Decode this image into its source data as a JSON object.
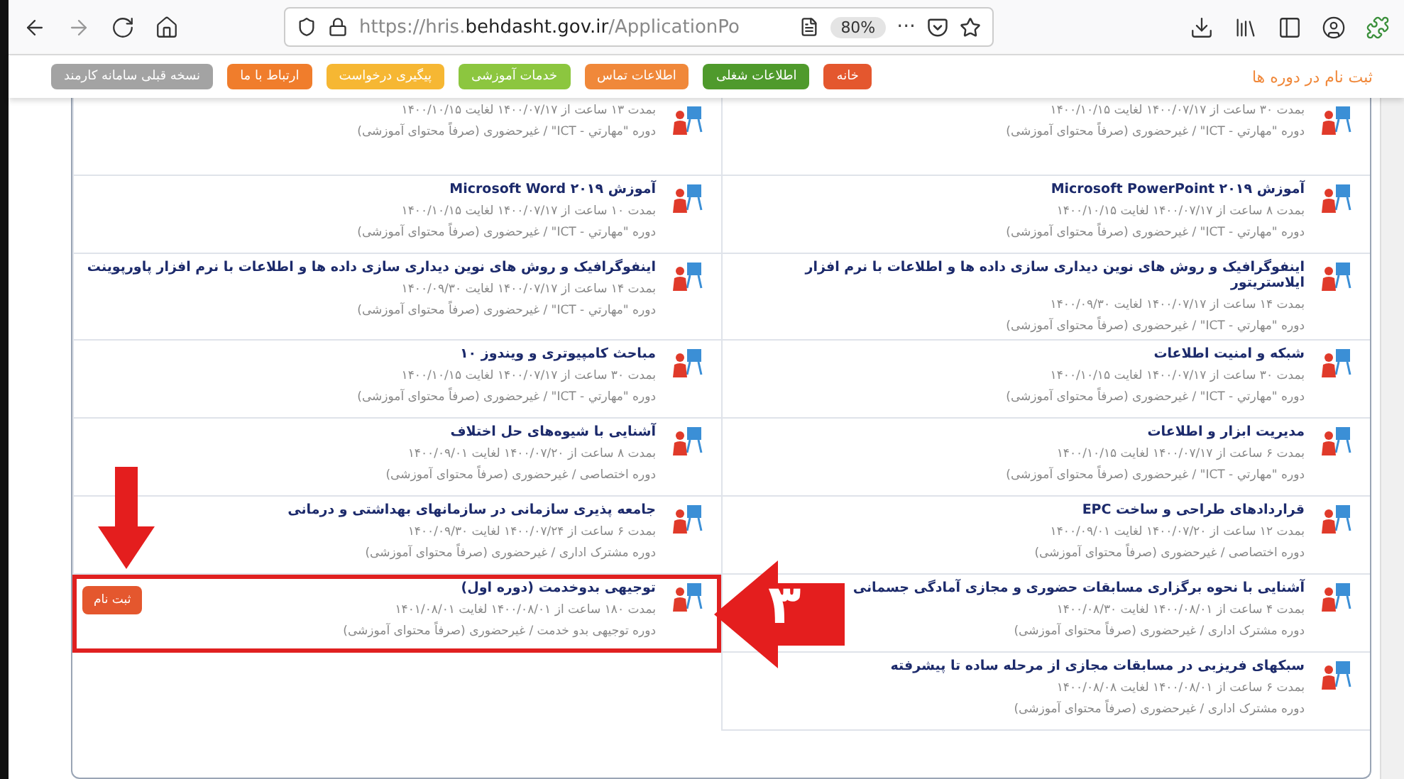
{
  "browser": {
    "url": "https://hris.**behdasht.gov.ir**/ApplicationPo",
    "zoom": "80%",
    "menu_dots": "···"
  },
  "nav": {
    "title": "ثبت نام در دوره ها",
    "buttons": [
      {
        "label": "خانه",
        "color": "#e4572e"
      },
      {
        "label": "اطلاعات شغلی",
        "color": "#4f9a2c"
      },
      {
        "label": "اطلاعات تماس",
        "color": "#f0883a"
      },
      {
        "label": "خدمات آموزشی",
        "color": "#8cc63f"
      },
      {
        "label": "پیگیری درخواست",
        "color": "#f6b733"
      },
      {
        "label": "ارتباط با ما",
        "color": "#f07d2c"
      },
      {
        "label": "نسخه قبلی سامانه کارمند",
        "color": "#a3a3a3"
      }
    ]
  },
  "courses_right": [
    {
      "duration": "بمدت ۳۰ ساعت از ۱۴۰۰/۰۷/۱۷ لغایت ۱۴۰۰/۱۰/۱۵",
      "type": "دوره \"مهارتي - ICT\" / غیرحضوری (صرفاً محتوای آموزشی)"
    },
    {
      "title": "آموزش Microsoft PowerPoint ۲۰۱۹",
      "duration": "بمدت ۸ ساعت از ۱۴۰۰/۰۷/۱۷ لغایت ۱۴۰۰/۱۰/۱۵",
      "type": "دوره \"مهارتي - ICT\" / غیرحضوری (صرفاً محتوای آموزشی)"
    },
    {
      "title": "اینفوگرافیک و روش های نوین دیداری سازی داده ها و اطلاعات با نرم افزار ایلاستریتور",
      "duration": "بمدت ۱۴ ساعت از ۱۴۰۰/۰۷/۱۷ لغایت ۱۴۰۰/۰۹/۳۰",
      "type": "دوره \"مهارتي - ICT\" / غیرحضوری (صرفاً محتوای آموزشی)"
    },
    {
      "title": "شبکه و امنیت اطلاعات",
      "duration": "بمدت ۳۰ ساعت از ۱۴۰۰/۰۷/۱۷ لغایت ۱۴۰۰/۱۰/۱۵",
      "type": "دوره \"مهارتي - ICT\" / غیرحضوری (صرفاً محتوای آموزشی)"
    },
    {
      "title": "مدیریت ابزار و اطلاعات",
      "duration": "بمدت ۶ ساعت از ۱۴۰۰/۰۷/۱۷ لغایت ۱۴۰۰/۱۰/۱۵",
      "type": "دوره \"مهارتي - ICT\" / غیرحضوری (صرفاً محتوای آموزشی)"
    },
    {
      "title": "قراردادهای طراحی و ساخت EPC",
      "duration": "بمدت ۱۲ ساعت از ۱۴۰۰/۰۷/۲۰ لغایت ۱۴۰۰/۰۹/۰۱",
      "type": "دوره اختصاصی / غیرحضوری (صرفاً محتوای آموزشی)"
    },
    {
      "title": "آشنایی با نحوه برگزاری مسابقات حضوری و مجازی آمادگی جسمانی",
      "duration": "بمدت ۴ ساعت از ۱۴۰۰/۰۸/۰۱ لغایت ۱۴۰۰/۰۸/۳۰",
      "type": "دوره مشترک اداری / غیرحضوری (صرفاً محتوای آموزشی)"
    },
    {
      "title": "سبکهای فریزبی در مسابقات مجازی از مرحله ساده تا پیشرفته",
      "duration": "بمدت ۶ ساعت از ۱۴۰۰/۰۸/۰۱ لغایت ۱۴۰۰/۰۸/۰۸",
      "type": "دوره مشترک اداری / غیرحضوری (صرفاً محتوای آموزشی)"
    }
  ],
  "courses_left": [
    {
      "duration": "بمدت ۱۳ ساعت از ۱۴۰۰/۰۷/۱۷ لغایت ۱۴۰۰/۱۰/۱۵",
      "type": "دوره \"مهارتي - ICT\" / غیرحضوری (صرفاً محتوای آموزشی)"
    },
    {
      "title": "آموزش Microsoft Word ۲۰۱۹",
      "duration": "بمدت ۱۰ ساعت از ۱۴۰۰/۰۷/۱۷ لغایت ۱۴۰۰/۱۰/۱۵",
      "type": "دوره \"مهارتي - ICT\" / غیرحضوری (صرفاً محتوای آموزشی)"
    },
    {
      "title": "اینفوگرافیک و روش های نوین دیداری سازی داده ها و اطلاعات با نرم افزار پاورپوینت",
      "duration": "بمدت ۱۴ ساعت از ۱۴۰۰/۰۷/۱۷ لغایت ۱۴۰۰/۰۹/۳۰",
      "type": "دوره \"مهارتي - ICT\" / غیرحضوری (صرفاً محتوای آموزشی)"
    },
    {
      "title": "مباحث کامپیوتری و ویندوز ۱۰",
      "duration": "بمدت ۳۰ ساعت از ۱۴۰۰/۰۷/۱۷ لغایت ۱۴۰۰/۱۰/۱۵",
      "type": "دوره \"مهارتي - ICT\" / غیرحضوری (صرفاً محتوای آموزشی)"
    },
    {
      "title": "آشنایی با شیوه‌های حل اختلاف",
      "duration": "بمدت ۸ ساعت از ۱۴۰۰/۰۷/۲۰ لغایت ۱۴۰۰/۰۹/۰۱",
      "type": "دوره اختصاصی / غیرحضوری (صرفاً محتوای آموزشی)"
    },
    {
      "title": "جامعه پذیری سازمانی در سازمانهای بهداشتی و درمانی",
      "duration": "بمدت ۶ ساعت از ۱۴۰۰/۰۷/۲۴ لغایت ۱۴۰۰/۰۹/۳۰",
      "type": "دوره مشترک اداری / غیرحضوری (صرفاً محتوای آموزشی)"
    },
    {
      "title": "توجیهی بدوخدمت (دوره اول)",
      "duration": "بمدت ۱۸۰ ساعت از ۱۴۰۰/۰۸/۰۱ لغایت ۱۴۰۱/۰۸/۰۱",
      "type": "دوره توجیهی بدو خدمت / غیرحضوری (صرفاً محتوای آموزشی)",
      "register_button": "ثبت نام",
      "highlighted": true
    }
  ],
  "annotation": {
    "step": "۳"
  }
}
